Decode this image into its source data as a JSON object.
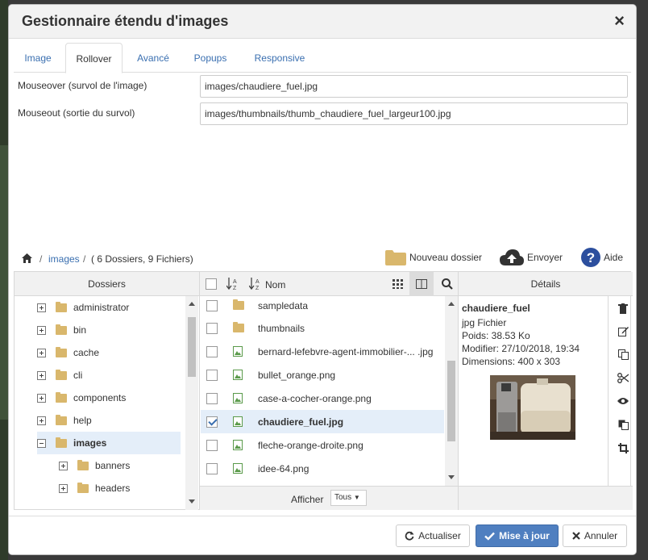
{
  "dialog": {
    "title": "Gestionnaire étendu d'images",
    "close_label": "×"
  },
  "tabs": [
    {
      "label": "Image"
    },
    {
      "label": "Rollover",
      "active": true
    },
    {
      "label": "Avancé"
    },
    {
      "label": "Popups"
    },
    {
      "label": "Responsive"
    }
  ],
  "rollover": {
    "mouseover_label": "Mouseover (survol de l'image)",
    "mouseover_value": "images/chaudiere_fuel.jpg",
    "mouseout_label": "Mouseout (sortie du survol)",
    "mouseout_value": "images/thumbnails/thumb_chaudiere_fuel_largeur100.jpg"
  },
  "browser": {
    "breadcrumb_sep": "/",
    "breadcrumb_folder": "images",
    "summary": "( 6 Dossiers, 9 Fichiers)",
    "new_folder_label": "Nouveau dossier",
    "upload_label": "Envoyer",
    "help_label": "Aide"
  },
  "folders_pane": {
    "header": "Dossiers",
    "items": [
      {
        "label": "administrator"
      },
      {
        "label": "bin"
      },
      {
        "label": "cache"
      },
      {
        "label": "cli"
      },
      {
        "label": "components"
      },
      {
        "label": "help"
      },
      {
        "label": "images",
        "expanded": true,
        "selected": true
      },
      {
        "label": "banners",
        "child": true
      },
      {
        "label": "headers",
        "child": true
      }
    ]
  },
  "files_pane": {
    "sort_name_label": "Nom",
    "rows": [
      {
        "name": "sampledata",
        "type": "folder"
      },
      {
        "name": "thumbnails",
        "type": "folder"
      },
      {
        "name": "bernard-lefebvre-agent-immobilier-... .jpg",
        "type": "image"
      },
      {
        "name": "bullet_orange.png",
        "type": "image"
      },
      {
        "name": "case-a-cocher-orange.png",
        "type": "image"
      },
      {
        "name": "chaudiere_fuel.jpg",
        "type": "image",
        "checked": true
      },
      {
        "name": "fleche-orange-droite.png",
        "type": "image"
      },
      {
        "name": "idee-64.png",
        "type": "image"
      }
    ],
    "show_label": "Afficher",
    "show_value": "Tous"
  },
  "details_pane": {
    "header": "Détails",
    "name": "chaudiere_fuel",
    "type": "jpg Fichier",
    "size": "Poids: 38.53 Ko",
    "modified": "Modifier: 27/10/2018, 19:34",
    "dimensions": "Dimensions: 400 x 303"
  },
  "footer": {
    "refresh_label": "Actualiser",
    "update_label": "Mise à jour",
    "cancel_label": "Annuler"
  },
  "colors": {
    "accent": "#4f7fc0",
    "link": "#3a6fb0",
    "folder": "#d9b76c",
    "selection": "#e4eef9"
  }
}
